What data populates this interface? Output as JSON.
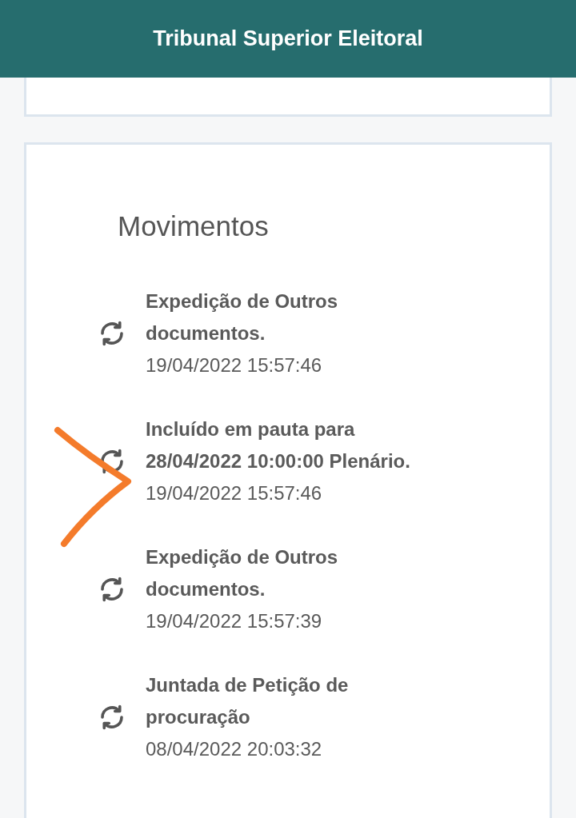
{
  "header": {
    "title": "Tribunal Superior Eleitoral"
  },
  "section": {
    "title": "Movimentos"
  },
  "movements": [
    {
      "description_lines": [
        "Expedição de Outros",
        "documentos."
      ],
      "timestamp": "19/04/2022 15:57:46"
    },
    {
      "description_lines": [
        "Incluído em pauta para",
        "28/04/2022 10:00:00 Plenário."
      ],
      "timestamp": "19/04/2022 15:57:46"
    },
    {
      "description_lines": [
        "Expedição de Outros",
        "documentos."
      ],
      "timestamp": "19/04/2022 15:57:39"
    },
    {
      "description_lines": [
        "Juntada de Petição de",
        "procuração"
      ],
      "timestamp": "08/04/2022 20:03:32"
    }
  ]
}
